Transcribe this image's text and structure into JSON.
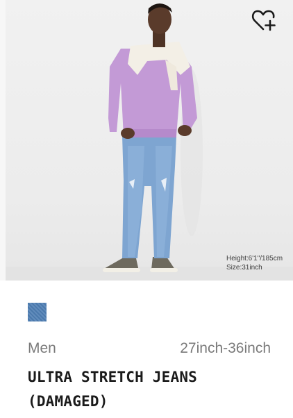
{
  "product": {
    "image_alt": "Model wearing lilac sweater and light blue damaged jeans",
    "model_height": "Height:6'1\"/185cm",
    "model_size": "Size:31inch",
    "gender": "Men",
    "size_range": "27inch-36inch",
    "title_line1": "ULTRA STRETCH JEANS",
    "title_line2": "(DAMAGED)"
  },
  "swatch": {
    "color": "#4f7fb5"
  },
  "icons": {
    "wishlist": "heart-plus-icon"
  }
}
